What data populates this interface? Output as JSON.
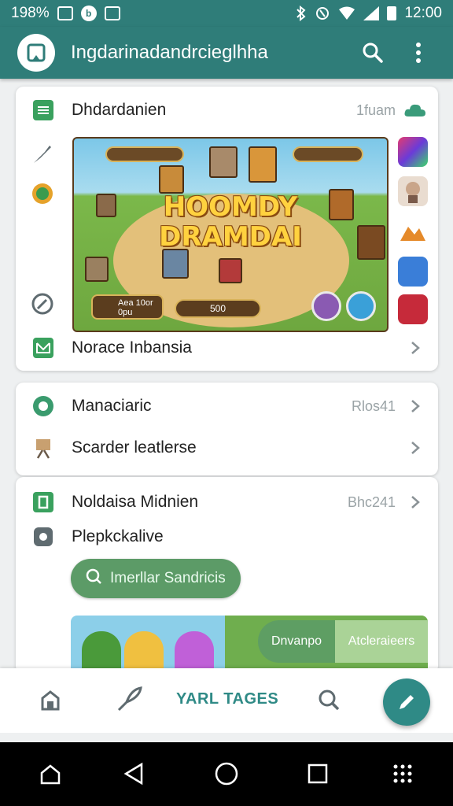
{
  "status_bar": {
    "battery_text": "198%",
    "time": "12:00",
    "icons": [
      "image-icon",
      "notification-icon",
      "alert-box-icon",
      "bluetooth-icon",
      "nfc-icon",
      "wifi-icon",
      "signal-icon",
      "battery-icon"
    ]
  },
  "app_bar": {
    "title": "Ingdarinadandrcieglhha",
    "icons": [
      "app-logo-icon",
      "search-icon",
      "more-vert-icon"
    ]
  },
  "card1": {
    "header_label": "Dhdardanien",
    "header_meta": "1fuam",
    "footer_label": "Norace Inbansia",
    "game": {
      "title_line1": "HOOMDY",
      "title_line2": "DRAMDAI",
      "hud_bottom_line1": "Aea 10or",
      "hud_bottom_line2": "0pu",
      "hud_counter": "500"
    },
    "side_icons_left": [
      "brush-icon",
      "coin-icon",
      "edit-icon"
    ],
    "side_thumbs_right": [
      "game-thumb-1",
      "game-thumb-2",
      "game-thumb-3",
      "game-thumb-4",
      "game-thumb-5"
    ]
  },
  "card2": {
    "rows": [
      {
        "label": "Manaciaric",
        "meta": "Rlos41"
      },
      {
        "label": "Scarder leatlerse",
        "meta": ""
      }
    ]
  },
  "card3": {
    "rows": [
      {
        "label": "Noldaisa Midnien",
        "meta": "Bhc241"
      },
      {
        "label": "Plepkckalive",
        "meta": ""
      }
    ],
    "chip_label": "Imerllar Sandricis",
    "preview_chip1": "Dnvanpo",
    "preview_chip2": "Atcleraieers"
  },
  "bottom_nav": {
    "label": "YARL TAGES",
    "icons": [
      "home-icon",
      "quill-icon",
      "search-icon",
      "pen-icon"
    ]
  },
  "colors": {
    "primary": "#2f7d79",
    "accent": "#2f8a86",
    "chip": "#5c9b67"
  }
}
